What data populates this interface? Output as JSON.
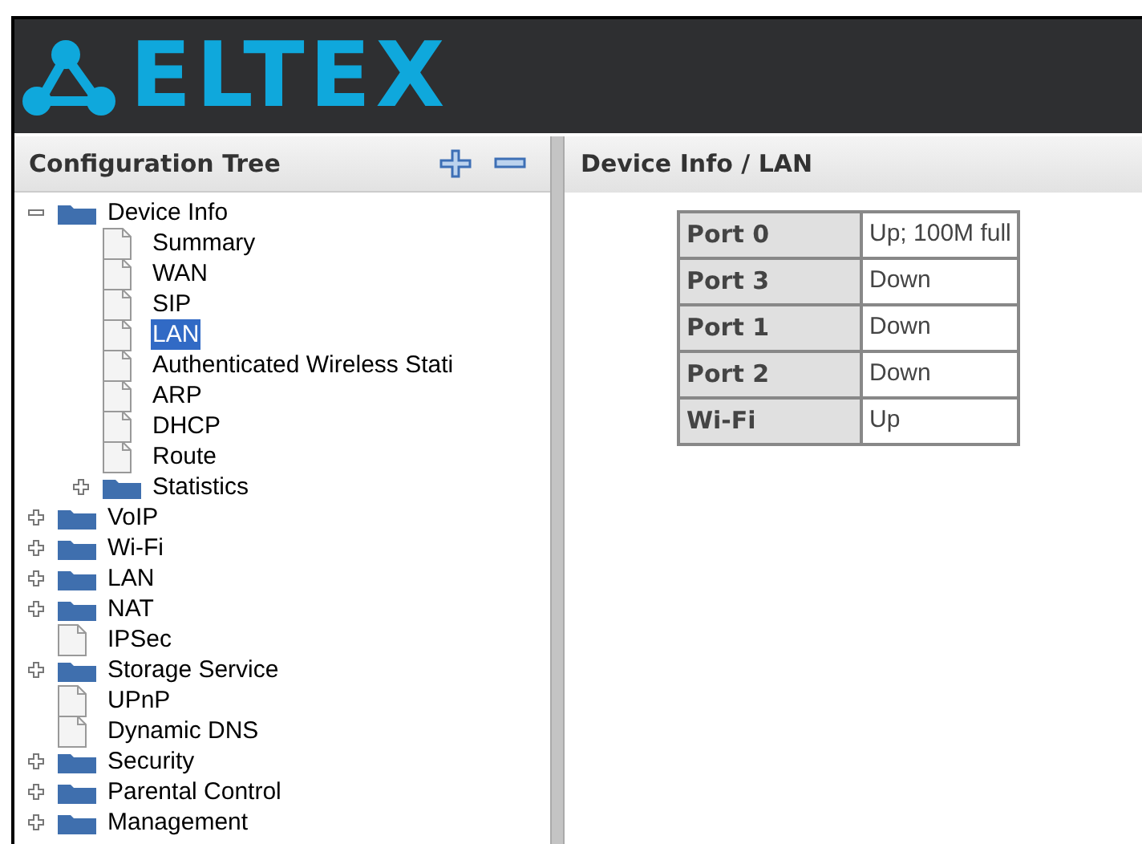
{
  "logo": {
    "text": "ELTEX"
  },
  "tree_panel": {
    "title": "Configuration Tree",
    "items": [
      {
        "label": "Device Info",
        "kind": "folder",
        "expanded": true,
        "selected": false,
        "children": [
          {
            "label": "Summary",
            "kind": "page",
            "selected": false
          },
          {
            "label": "WAN",
            "kind": "page",
            "selected": false
          },
          {
            "label": "SIP",
            "kind": "page",
            "selected": false
          },
          {
            "label": "LAN",
            "kind": "page",
            "selected": true
          },
          {
            "label": "Authenticated Wireless Stati",
            "kind": "page",
            "selected": false
          },
          {
            "label": "ARP",
            "kind": "page",
            "selected": false
          },
          {
            "label": "DHCP",
            "kind": "page",
            "selected": false
          },
          {
            "label": "Route",
            "kind": "page",
            "selected": false
          },
          {
            "label": "Statistics",
            "kind": "folder",
            "expanded": false,
            "selected": false
          }
        ]
      },
      {
        "label": "VoIP",
        "kind": "folder",
        "expanded": false,
        "selected": false
      },
      {
        "label": "Wi-Fi",
        "kind": "folder",
        "expanded": false,
        "selected": false
      },
      {
        "label": "LAN",
        "kind": "folder",
        "expanded": false,
        "selected": false
      },
      {
        "label": "NAT",
        "kind": "folder",
        "expanded": false,
        "selected": false
      },
      {
        "label": "IPSec",
        "kind": "page",
        "selected": false
      },
      {
        "label": "Storage Service",
        "kind": "folder",
        "expanded": false,
        "selected": false
      },
      {
        "label": "UPnP",
        "kind": "page",
        "selected": false
      },
      {
        "label": "Dynamic DNS",
        "kind": "page",
        "selected": false
      },
      {
        "label": "Security",
        "kind": "folder",
        "expanded": false,
        "selected": false
      },
      {
        "label": "Parental Control",
        "kind": "folder",
        "expanded": false,
        "selected": false
      },
      {
        "label": "Management",
        "kind": "folder",
        "expanded": false,
        "selected": false
      }
    ]
  },
  "content": {
    "breadcrumb": "Device Info / LAN",
    "table": {
      "rows": [
        {
          "port": "Port 0",
          "status": "Up; 100M full"
        },
        {
          "port": "Port 3",
          "status": "Down"
        },
        {
          "port": "Port 1",
          "status": "Down"
        },
        {
          "port": "Port 2",
          "status": "Down"
        },
        {
          "port": "Wi-Fi",
          "status": "Up"
        }
      ]
    }
  }
}
